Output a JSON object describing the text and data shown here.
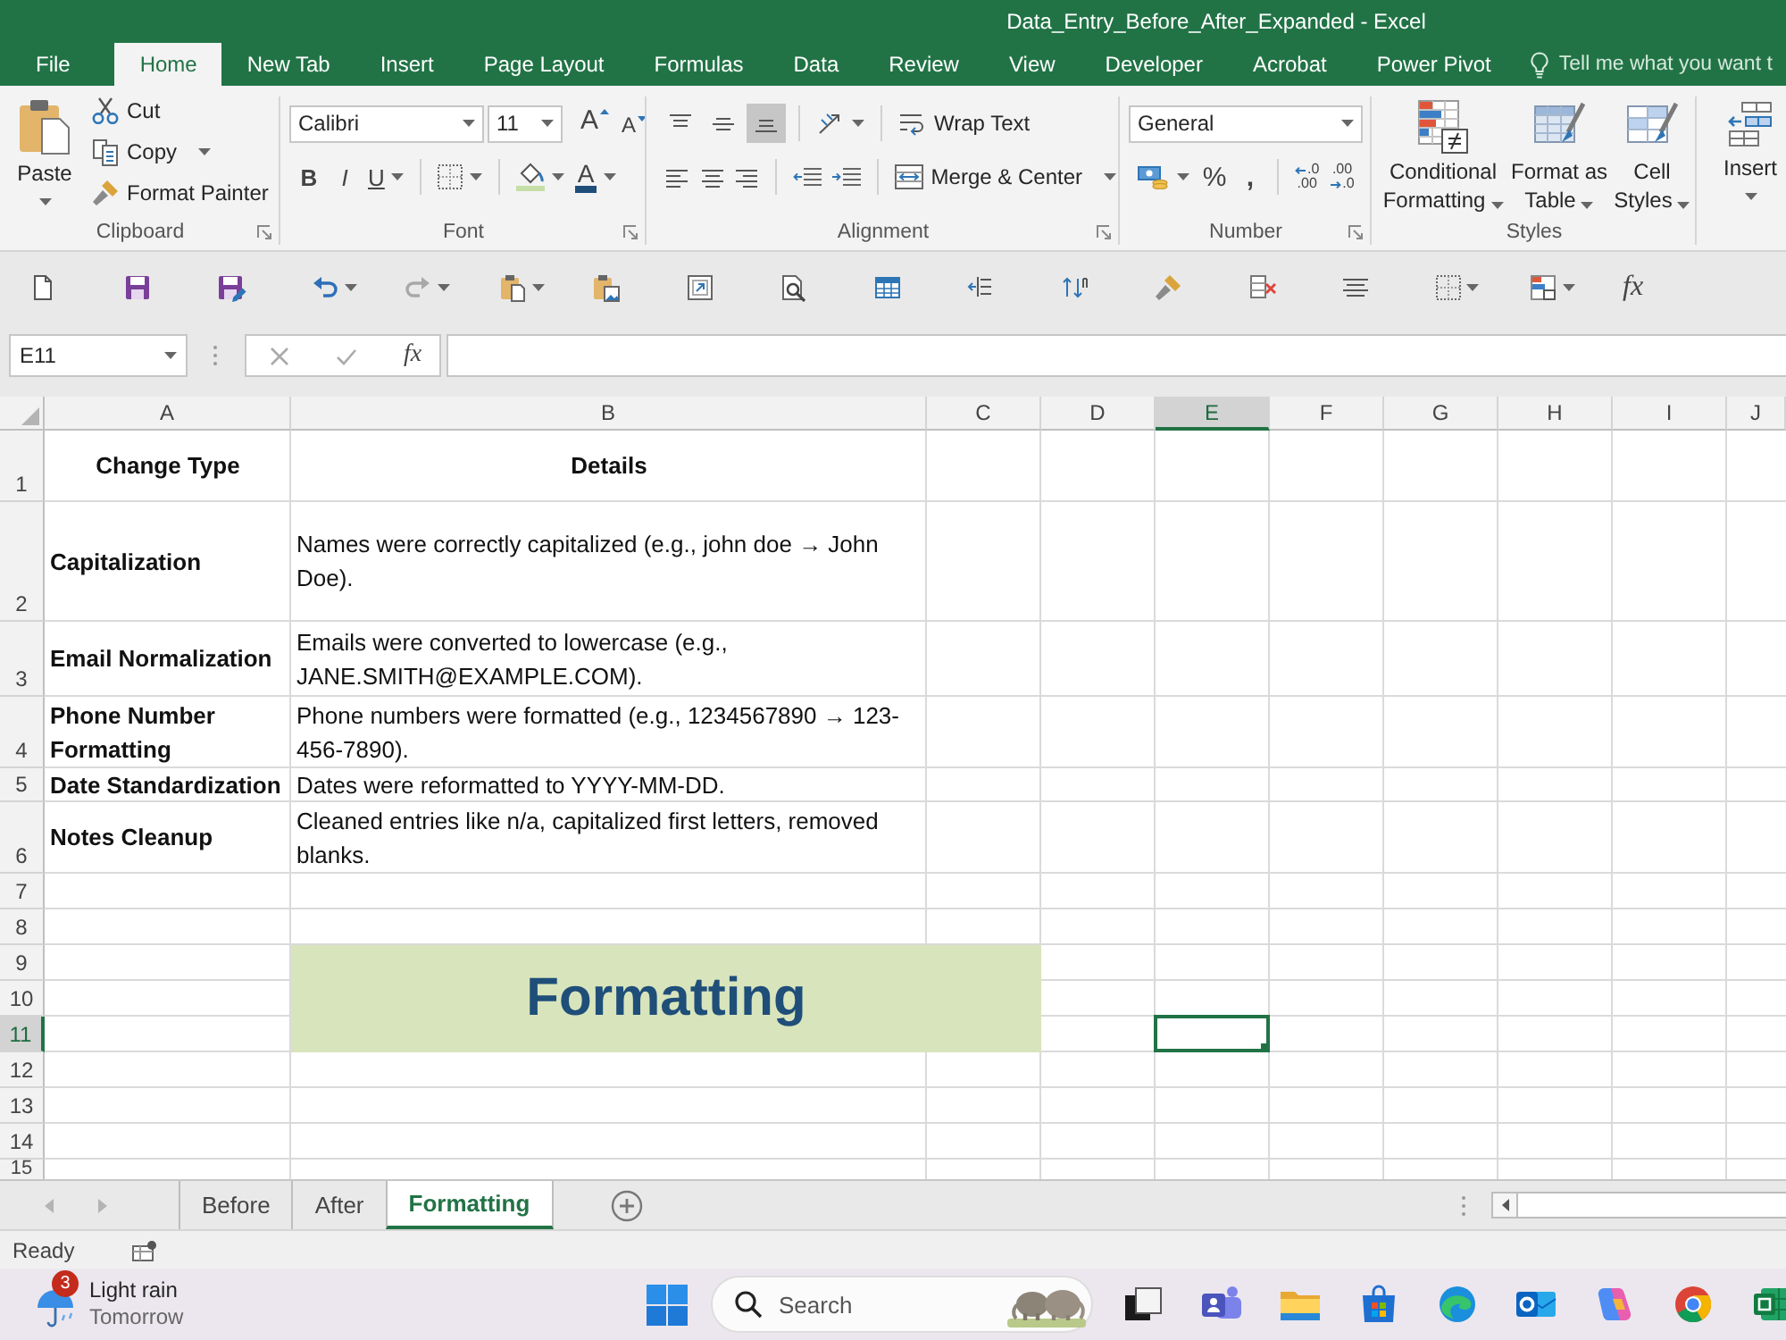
{
  "window": {
    "title": "Data_Entry_Before_After_Expanded - Excel"
  },
  "ribbon_tabs": [
    {
      "label": "File",
      "selected": false
    },
    {
      "label": "Home",
      "selected": true
    },
    {
      "label": "New Tab",
      "selected": false
    },
    {
      "label": "Insert",
      "selected": false
    },
    {
      "label": "Page Layout",
      "selected": false
    },
    {
      "label": "Formulas",
      "selected": false
    },
    {
      "label": "Data",
      "selected": false
    },
    {
      "label": "Review",
      "selected": false
    },
    {
      "label": "View",
      "selected": false
    },
    {
      "label": "Developer",
      "selected": false
    },
    {
      "label": "Acrobat",
      "selected": false
    },
    {
      "label": "Power Pivot",
      "selected": false
    }
  ],
  "tell_me": {
    "placeholder": "Tell me what you want t"
  },
  "ribbon": {
    "clipboard": {
      "label": "Clipboard",
      "paste": "Paste",
      "cut": "Cut",
      "copy": "Copy",
      "format_painter": "Format Painter"
    },
    "font": {
      "label": "Font",
      "font_name": "Calibri",
      "font_size": "11",
      "grow_font": "A",
      "shrink_font": "A",
      "bold": "B",
      "italic": "I",
      "underline": "U",
      "font_color": "A"
    },
    "alignment": {
      "label": "Alignment",
      "vertical": [
        {
          "kind": "top",
          "selected": false
        },
        {
          "kind": "middle",
          "selected": false
        },
        {
          "kind": "bottom",
          "selected": true
        }
      ],
      "horizontal": [
        {
          "kind": "left",
          "selected": false
        },
        {
          "kind": "center",
          "selected": false
        },
        {
          "kind": "right",
          "selected": false
        }
      ],
      "wrap_text": "Wrap Text",
      "merge_center": "Merge & Center"
    },
    "number": {
      "label": "Number",
      "format": "General",
      "percent": "%",
      "comma": ",",
      "increase_decimal": [
        ".0",
        ".00"
      ],
      "decrease_decimal": [
        ".00",
        ".0"
      ]
    },
    "styles": {
      "label": "Styles",
      "buttons": [
        {
          "kind": "conditional",
          "label": "Conditional Formatting"
        },
        {
          "kind": "table",
          "label": "Format as Table"
        },
        {
          "kind": "cell_styles",
          "label": "Cell Styles"
        }
      ]
    },
    "cells": {
      "insert": "Insert"
    }
  },
  "quick_access_toolbar": {
    "function": "fx"
  },
  "formula_bar": {
    "name_box": "E11",
    "function": "fx"
  },
  "sheet": {
    "columns": [
      {
        "label": "A",
        "selected": false
      },
      {
        "label": "B",
        "selected": false
      },
      {
        "label": "C",
        "selected": false
      },
      {
        "label": "D",
        "selected": false
      },
      {
        "label": "E",
        "selected": true
      },
      {
        "label": "F",
        "selected": false
      },
      {
        "label": "G",
        "selected": false
      },
      {
        "label": "H",
        "selected": false
      },
      {
        "label": "I",
        "selected": false
      },
      {
        "label": "J",
        "selected": false
      }
    ],
    "rows": [
      {
        "label": "1",
        "selected": false,
        "cells": [
          {
            "kind": "heading",
            "text": "Change Type"
          },
          {
            "kind": "heading",
            "text": "Details"
          }
        ]
      },
      {
        "label": "2",
        "selected": false,
        "cells": [
          {
            "kind": "label",
            "text": "Capitalization"
          },
          {
            "kind": "text",
            "text": "Names were correctly capitalized (e.g., john doe → John Doe)."
          }
        ]
      },
      {
        "label": "3",
        "selected": false,
        "cells": [
          {
            "kind": "label",
            "text": "Email Normalization"
          },
          {
            "kind": "text",
            "text": "Emails were converted to lowercase (e.g., JANE.SMITH@EXAMPLE.COM)."
          }
        ]
      },
      {
        "label": "4",
        "selected": false,
        "cells": [
          {
            "kind": "label",
            "text": "Phone Number Formatting"
          },
          {
            "kind": "text",
            "text": "Phone numbers were formatted (e.g., 1234567890 → 123-456-7890)."
          }
        ]
      },
      {
        "label": "5",
        "selected": false,
        "cells": [
          {
            "kind": "label",
            "text": "Date Standardization"
          },
          {
            "kind": "text",
            "text": "Dates were reformatted to YYYY-MM-DD."
          }
        ]
      },
      {
        "label": "6",
        "selected": false,
        "cells": [
          {
            "kind": "label",
            "text": "Notes Cleanup"
          },
          {
            "kind": "text",
            "text": "Cleaned entries like n/a, capitalized first letters, removed blanks."
          }
        ]
      },
      {
        "label": "7",
        "selected": false
      },
      {
        "label": "8",
        "selected": false
      },
      {
        "label": "9",
        "selected": false
      },
      {
        "label": "10",
        "selected": false
      },
      {
        "label": "11",
        "selected": true
      },
      {
        "label": "12",
        "selected": false
      },
      {
        "label": "13",
        "selected": false
      },
      {
        "label": "14",
        "selected": false
      },
      {
        "label": "15",
        "selected": false
      }
    ],
    "merged_cell": {
      "text": "Formatting"
    }
  },
  "sheet_tabs": [
    {
      "label": "Before",
      "selected": false
    },
    {
      "label": "After",
      "selected": false
    },
    {
      "label": "Formatting",
      "selected": true
    }
  ],
  "status_bar": {
    "text": "Ready"
  },
  "taskbar": {
    "weather": {
      "badge": "3",
      "condition": "Light rain",
      "time": "Tomorrow"
    },
    "search": {
      "placeholder": "Search"
    }
  }
}
